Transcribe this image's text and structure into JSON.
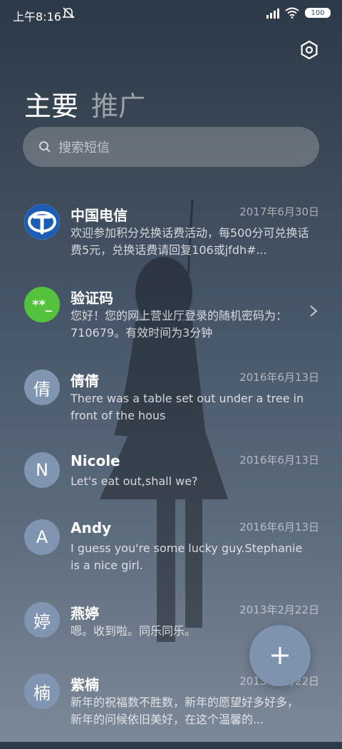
{
  "status_bar": {
    "time": "上午8:16",
    "battery": "100"
  },
  "tabs": [
    {
      "label": "主要"
    },
    {
      "label": "推广"
    }
  ],
  "search": {
    "placeholder": "搜索短信"
  },
  "conversations": [
    {
      "name": "中国电信",
      "date": "2017年6月30日",
      "preview": "欢迎参加积分兑换话费活动，每500分可兑换话费5元，兑换话费请回复106或jfdh#...",
      "avatar_text": "",
      "avatar_color": "#1d5cb5"
    },
    {
      "name": "验证码",
      "date": "",
      "preview": "您好！您的网上营业厅登录的随机密码为：710679。有效时间为3分钟",
      "avatar_text": "**_",
      "avatar_color": "#55c23e"
    },
    {
      "name": "倩倩",
      "date": "2016年6月13日",
      "preview": "There was a table set out under a tree in front of the hous",
      "avatar_text": "倩",
      "avatar_color": "#7f95b2"
    },
    {
      "name": "Nicole",
      "date": "2016年6月13日",
      "preview": "Let's eat out,shall we?",
      "avatar_text": "N",
      "avatar_color": "#7f95b2"
    },
    {
      "name": "Andy",
      "date": "2016年6月13日",
      "preview": "I guess you're some lucky guy.Stephanie is a nice girl.",
      "avatar_text": "A",
      "avatar_color": "#7f95b2"
    },
    {
      "name": "燕婷",
      "date": "2013年2月22日",
      "preview": "嗯。收到啦。同乐同乐。",
      "avatar_text": "婷",
      "avatar_color": "#7f95b2"
    },
    {
      "name": "紫楠",
      "date": "2013年2月22日",
      "preview": "新年的祝福数不胜数，新年的愿望好多好多，新年的问候依旧美好，在这个温馨的...",
      "avatar_text": "楠",
      "avatar_color": "#7f95b2"
    }
  ],
  "icons": {
    "settings": "hexagon-gear-icon",
    "search": "search-icon",
    "compose": "plus-icon",
    "more": "chevron-right-icon"
  },
  "colors": {
    "fab": "#7e93ad"
  }
}
